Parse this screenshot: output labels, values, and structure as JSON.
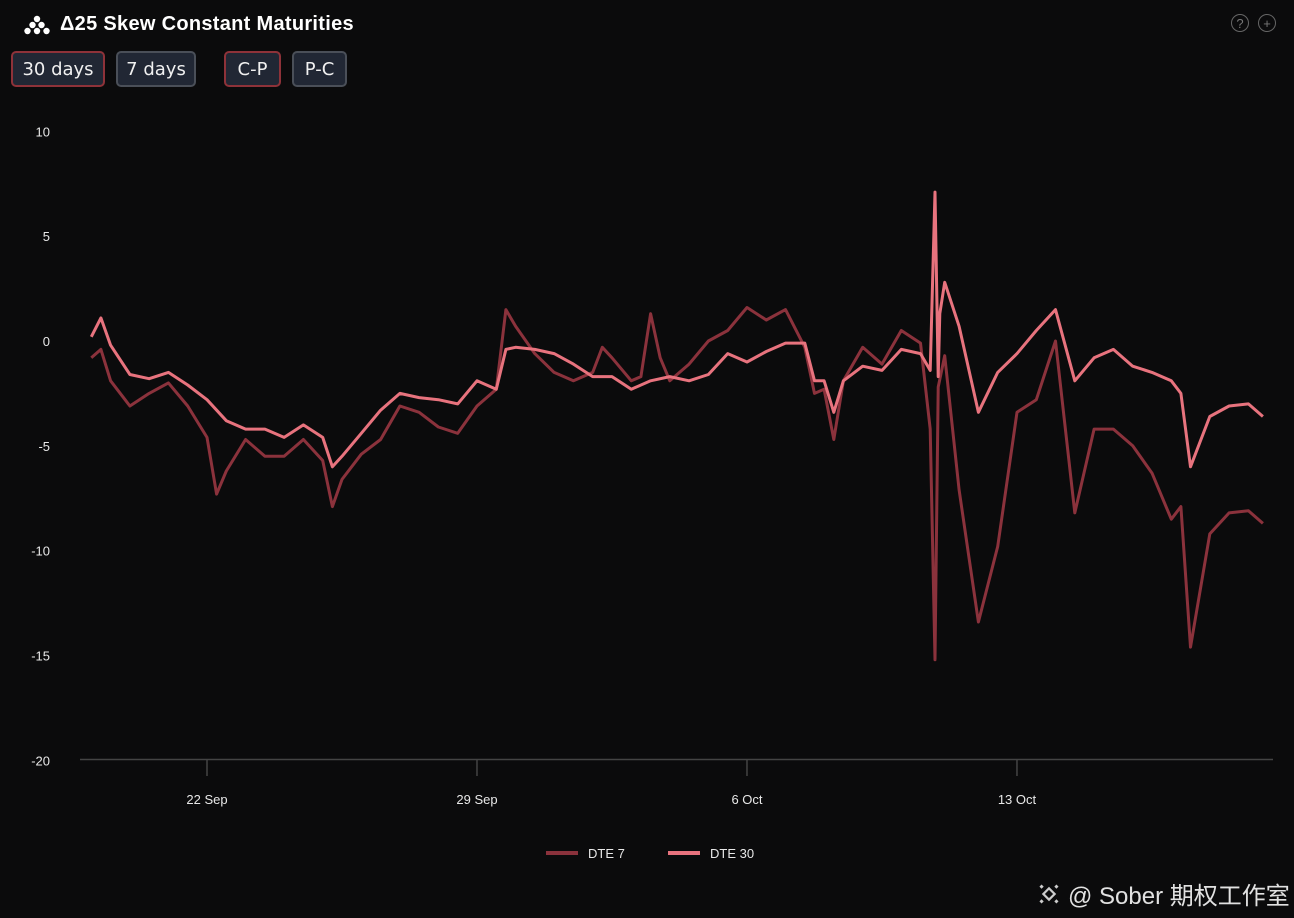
{
  "header": {
    "title": "Δ25 Skew Constant Maturities",
    "logo_icon": "dots-pyramid-icon",
    "help_icon": "?",
    "add_icon": "+"
  },
  "buttons": {
    "maturity": [
      {
        "label": "30 days",
        "active": true
      },
      {
        "label": "7 days",
        "active": false
      }
    ],
    "direction": [
      {
        "label": "C-P",
        "active": true
      },
      {
        "label": "P-C",
        "active": false
      }
    ]
  },
  "watermark": {
    "text": "@ Sober 期权工作室",
    "icon": "binance-diamond-icon"
  },
  "chart_data": {
    "type": "line",
    "title": "",
    "xlabel": "",
    "ylabel": "",
    "ylim": [
      -20,
      10
    ],
    "yticks": [
      "10",
      "5",
      "0",
      "-5",
      "-10",
      "-15",
      "-20"
    ],
    "ytick_values": [
      10,
      5,
      0,
      -5,
      -10,
      -15,
      -20
    ],
    "xticks": [
      "22 Sep",
      "29 Sep",
      "6 Oct",
      "13 Oct"
    ],
    "xtick_dates": [
      "Sep 22 00:00",
      "Sep 29 00:00",
      "Oct 6 00:00",
      "Oct 13 00:00"
    ],
    "xlim": [
      "Sep 18 17:00",
      "Oct 19 14:00"
    ],
    "grid": false,
    "legend": "bottom-center",
    "series": [
      {
        "name": "DTE 7",
        "color": "#8b323c",
        "points": [
          [
            "Sep 19 00:00",
            -0.8
          ],
          [
            "Sep 19 06:00",
            -0.4
          ],
          [
            "Sep 19 12:00",
            -1.9
          ],
          [
            "Sep 20 00:00",
            -3.1
          ],
          [
            "Sep 20 12:00",
            -2.5
          ],
          [
            "Sep 21 00:00",
            -2.0
          ],
          [
            "Sep 21 12:00",
            -3.1
          ],
          [
            "Sep 22 00:00",
            -4.6
          ],
          [
            "Sep 22 06:00",
            -7.3
          ],
          [
            "Sep 22 12:00",
            -6.2
          ],
          [
            "Sep 23 00:00",
            -4.7
          ],
          [
            "Sep 23 12:00",
            -5.5
          ],
          [
            "Sep 24 00:00",
            -5.5
          ],
          [
            "Sep 24 12:00",
            -4.7
          ],
          [
            "Sep 25 00:00",
            -5.7
          ],
          [
            "Sep 25 06:00",
            -7.9
          ],
          [
            "Sep 25 12:00",
            -6.6
          ],
          [
            "Sep 26 00:00",
            -5.4
          ],
          [
            "Sep 26 12:00",
            -4.7
          ],
          [
            "Sep 27 00:00",
            -3.1
          ],
          [
            "Sep 27 12:00",
            -3.4
          ],
          [
            "Sep 28 00:00",
            -4.1
          ],
          [
            "Sep 28 12:00",
            -4.4
          ],
          [
            "Sep 29 00:00",
            -3.1
          ],
          [
            "Sep 29 12:00",
            -2.3
          ],
          [
            "Sep 29 18:00",
            1.5
          ],
          [
            "Sep 30 00:00",
            0.7
          ],
          [
            "Sep 30 12:00",
            -0.6
          ],
          [
            "Oct 1 00:00",
            -1.5
          ],
          [
            "Oct 1 12:00",
            -1.9
          ],
          [
            "Oct 2 00:00",
            -1.5
          ],
          [
            "Oct 2 06:00",
            -0.3
          ],
          [
            "Oct 2 12:00",
            -0.8
          ],
          [
            "Oct 3 00:00",
            -1.9
          ],
          [
            "Oct 3 06:00",
            -1.7
          ],
          [
            "Oct 3 12:00",
            1.3
          ],
          [
            "Oct 3 18:00",
            -0.8
          ],
          [
            "Oct 4 00:00",
            -1.9
          ],
          [
            "Oct 4 12:00",
            -1.1
          ],
          [
            "Oct 5 00:00",
            0.0
          ],
          [
            "Oct 5 12:00",
            0.5
          ],
          [
            "Oct 6 00:00",
            1.6
          ],
          [
            "Oct 6 12:00",
            1.0
          ],
          [
            "Oct 7 00:00",
            1.5
          ],
          [
            "Oct 7 12:00",
            -0.3
          ],
          [
            "Oct 7 18:00",
            -2.5
          ],
          [
            "Oct 8 00:00",
            -2.3
          ],
          [
            "Oct 8 06:00",
            -4.7
          ],
          [
            "Oct 8 12:00",
            -1.9
          ],
          [
            "Oct 9 00:00",
            -0.3
          ],
          [
            "Oct 9 12:00",
            -1.1
          ],
          [
            "Oct 10 00:00",
            0.5
          ],
          [
            "Oct 10 12:00",
            -0.1
          ],
          [
            "Oct 10 18:00",
            -4.2
          ],
          [
            "Oct 10 21:00",
            -15.2
          ],
          [
            "Oct 10 23:00",
            -2.2
          ],
          [
            "Oct 11 03:00",
            -0.7
          ],
          [
            "Oct 11 12:00",
            -7.1
          ],
          [
            "Oct 12 00:00",
            -13.4
          ],
          [
            "Oct 12 12:00",
            -9.8
          ],
          [
            "Oct 13 00:00",
            -3.4
          ],
          [
            "Oct 13 12:00",
            -2.8
          ],
          [
            "Oct 14 00:00",
            0.0
          ],
          [
            "Oct 14 12:00",
            -8.2
          ],
          [
            "Oct 15 00:00",
            -4.2
          ],
          [
            "Oct 15 12:00",
            -4.2
          ],
          [
            "Oct 16 00:00",
            -5.0
          ],
          [
            "Oct 16 12:00",
            -6.3
          ],
          [
            "Oct 17 00:00",
            -8.5
          ],
          [
            "Oct 17 06:00",
            -7.9
          ],
          [
            "Oct 17 12:00",
            -14.6
          ],
          [
            "Oct 18 00:00",
            -9.2
          ],
          [
            "Oct 18 12:00",
            -8.2
          ],
          [
            "Oct 19 00:00",
            -8.1
          ],
          [
            "Oct 19 09:00",
            -8.7
          ]
        ]
      },
      {
        "name": "DTE 30",
        "color": "#e8737e",
        "points": [
          [
            "Sep 19 00:00",
            0.2
          ],
          [
            "Sep 19 06:00",
            1.1
          ],
          [
            "Sep 19 12:00",
            -0.2
          ],
          [
            "Sep 20 00:00",
            -1.6
          ],
          [
            "Sep 20 12:00",
            -1.8
          ],
          [
            "Sep 21 00:00",
            -1.5
          ],
          [
            "Sep 21 12:00",
            -2.1
          ],
          [
            "Sep 22 00:00",
            -2.8
          ],
          [
            "Sep 22 12:00",
            -3.8
          ],
          [
            "Sep 23 00:00",
            -4.2
          ],
          [
            "Sep 23 12:00",
            -4.2
          ],
          [
            "Sep 24 00:00",
            -4.6
          ],
          [
            "Sep 24 12:00",
            -4.0
          ],
          [
            "Sep 25 00:00",
            -4.6
          ],
          [
            "Sep 25 06:00",
            -6.0
          ],
          [
            "Sep 25 12:00",
            -5.5
          ],
          [
            "Sep 26 00:00",
            -4.4
          ],
          [
            "Sep 26 12:00",
            -3.3
          ],
          [
            "Sep 27 00:00",
            -2.5
          ],
          [
            "Sep 27 12:00",
            -2.7
          ],
          [
            "Sep 28 00:00",
            -2.8
          ],
          [
            "Sep 28 12:00",
            -3.0
          ],
          [
            "Sep 29 00:00",
            -1.9
          ],
          [
            "Sep 29 12:00",
            -2.3
          ],
          [
            "Sep 29 18:00",
            -0.4
          ],
          [
            "Sep 30 00:00",
            -0.3
          ],
          [
            "Sep 30 12:00",
            -0.4
          ],
          [
            "Oct 1 00:00",
            -0.6
          ],
          [
            "Oct 1 12:00",
            -1.1
          ],
          [
            "Oct 2 00:00",
            -1.7
          ],
          [
            "Oct 2 12:00",
            -1.7
          ],
          [
            "Oct 3 00:00",
            -2.3
          ],
          [
            "Oct 3 12:00",
            -1.9
          ],
          [
            "Oct 4 00:00",
            -1.7
          ],
          [
            "Oct 4 12:00",
            -1.9
          ],
          [
            "Oct 5 00:00",
            -1.6
          ],
          [
            "Oct 5 12:00",
            -0.6
          ],
          [
            "Oct 6 00:00",
            -1.0
          ],
          [
            "Oct 6 12:00",
            -0.5
          ],
          [
            "Oct 7 00:00",
            -0.1
          ],
          [
            "Oct 7 12:00",
            -0.1
          ],
          [
            "Oct 7 18:00",
            -1.9
          ],
          [
            "Oct 8 00:00",
            -1.9
          ],
          [
            "Oct 8 06:00",
            -3.4
          ],
          [
            "Oct 8 12:00",
            -1.9
          ],
          [
            "Oct 9 00:00",
            -1.2
          ],
          [
            "Oct 9 12:00",
            -1.4
          ],
          [
            "Oct 10 00:00",
            -0.4
          ],
          [
            "Oct 10 12:00",
            -0.6
          ],
          [
            "Oct 10 18:00",
            -1.4
          ],
          [
            "Oct 10 21:00",
            7.1
          ],
          [
            "Oct 10 23:00",
            -1.7
          ],
          [
            "Oct 11 00:00",
            1.3
          ],
          [
            "Oct 11 03:00",
            2.8
          ],
          [
            "Oct 11 12:00",
            0.7
          ],
          [
            "Oct 12 00:00",
            -3.4
          ],
          [
            "Oct 12 12:00",
            -1.5
          ],
          [
            "Oct 13 00:00",
            -0.6
          ],
          [
            "Oct 13 12:00",
            0.5
          ],
          [
            "Oct 14 00:00",
            1.5
          ],
          [
            "Oct 14 12:00",
            -1.9
          ],
          [
            "Oct 15 00:00",
            -0.8
          ],
          [
            "Oct 15 12:00",
            -0.4
          ],
          [
            "Oct 16 00:00",
            -1.2
          ],
          [
            "Oct 16 12:00",
            -1.5
          ],
          [
            "Oct 17 00:00",
            -1.9
          ],
          [
            "Oct 17 06:00",
            -2.5
          ],
          [
            "Oct 17 12:00",
            -6.0
          ],
          [
            "Oct 18 00:00",
            -3.6
          ],
          [
            "Oct 18 12:00",
            -3.1
          ],
          [
            "Oct 19 00:00",
            -3.0
          ],
          [
            "Oct 19 09:00",
            -3.6
          ]
        ]
      }
    ]
  }
}
